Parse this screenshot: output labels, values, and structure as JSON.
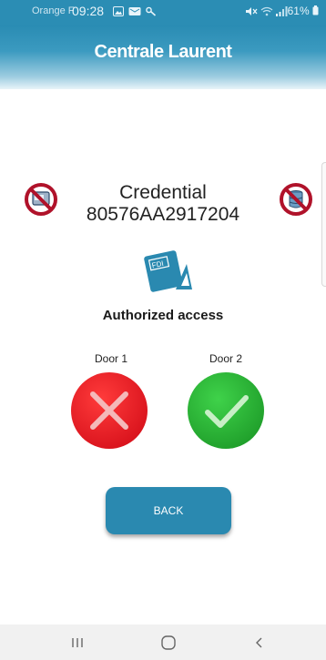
{
  "status_bar": {
    "carrier": "Orange F",
    "time": "09:28",
    "battery": "61%"
  },
  "header": {
    "title": "Centrale Laurent"
  },
  "credential": {
    "label": "Credential",
    "number": "80576AA2917204"
  },
  "card_icon_text": "FDI",
  "access_status": "Authorized access",
  "doors": [
    {
      "label": "Door 1",
      "status": "denied"
    },
    {
      "label": "Door 2",
      "status": "granted"
    }
  ],
  "back_button": {
    "label": "BACK"
  },
  "colors": {
    "primary": "#2a89b0",
    "denied": "#e8202a",
    "granted": "#28b432",
    "forbidden": "#b0122a"
  },
  "icons": {
    "left": "no-card-reader-icon",
    "right": "no-database-icon",
    "nav": [
      "recent-apps-icon",
      "home-icon",
      "back-nav-icon"
    ]
  }
}
